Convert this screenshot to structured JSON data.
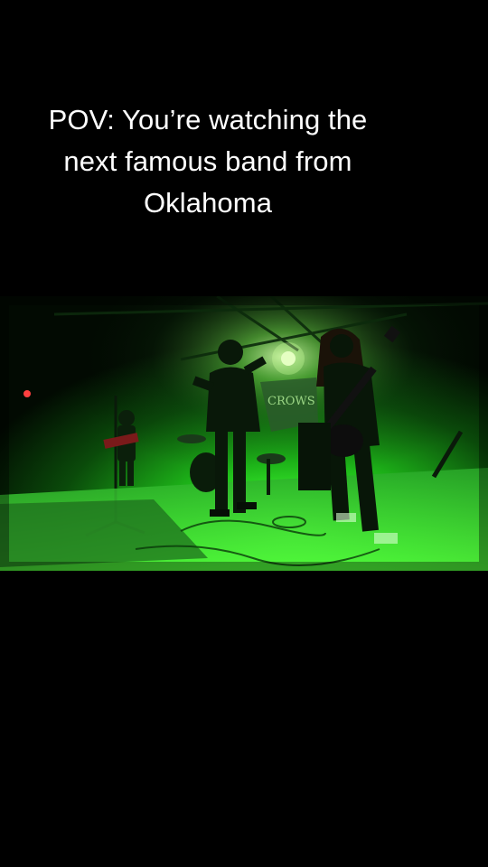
{
  "caption": {
    "lines": [
      "POV: You’re watching the",
      "next famous band from",
      "Oklahoma"
    ]
  },
  "video": {
    "description_icon": "concert-video-frame",
    "accent_color": "#22ff44",
    "background_color": "#000000"
  }
}
